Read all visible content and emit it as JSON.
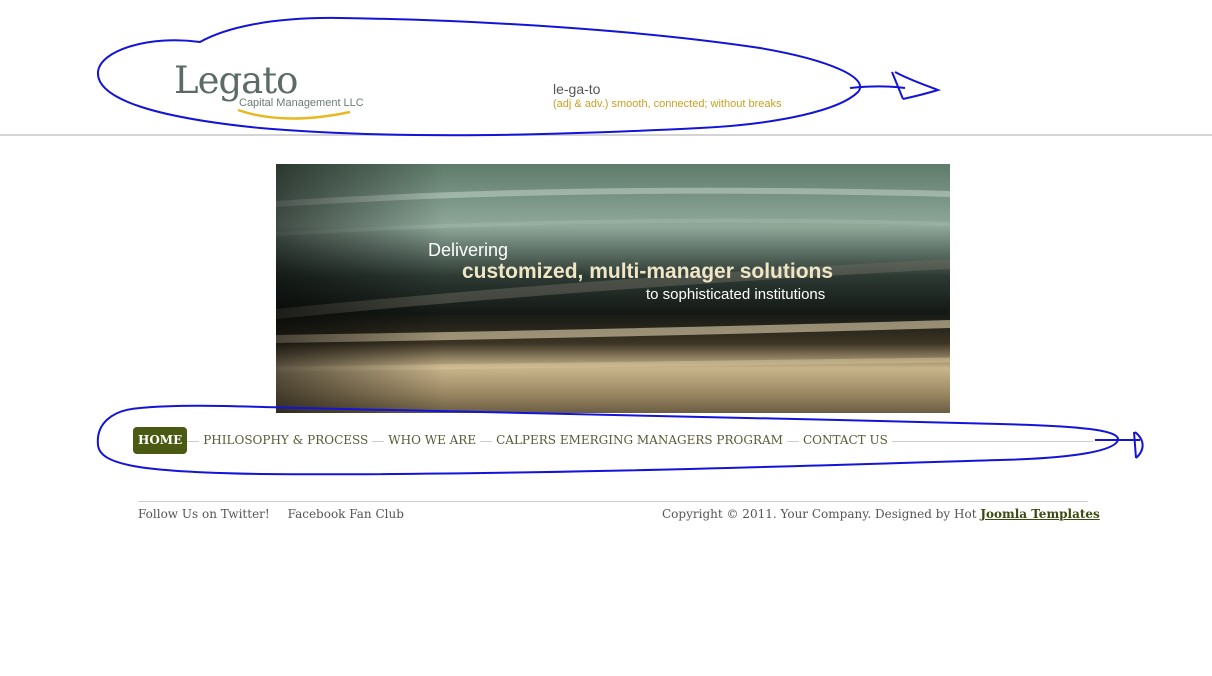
{
  "header": {
    "logo_word": "Legato",
    "logo_sub": "Capital Management LLC",
    "tag_word": "le-ga-to",
    "tag_definition": "(adj & adv.)  smooth, connected;  without breaks"
  },
  "banner": {
    "line1": "Delivering",
    "line2": "customized, multi-manager solutions",
    "line3": "to sophisticated institutions"
  },
  "nav": {
    "items": [
      {
        "label": "HOME"
      },
      {
        "label": "PHILOSOPHY & PROCESS"
      },
      {
        "label": "WHO WE ARE"
      },
      {
        "label": "CALPERS EMERGING MANAGERS PROGRAM"
      },
      {
        "label": "CONTACT US"
      }
    ],
    "active_index": 0
  },
  "footer": {
    "twitter": "Follow Us on Twitter!",
    "facebook": "Facebook Fan Club",
    "copyright": "Copyright © 2011. Your Company. Designed by Hot ",
    "templates_link": "Joomla Templates"
  },
  "colors": {
    "nav_active": "#4b5a12",
    "tagline_gold": "#c8a020",
    "annotation_ink": "#1010d8"
  }
}
